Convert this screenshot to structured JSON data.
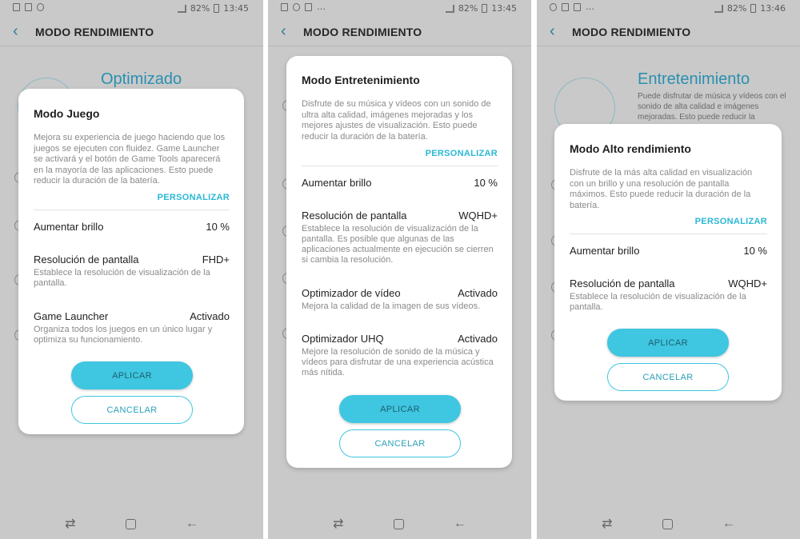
{
  "status": {
    "time1": "13:45",
    "time2": "13:45",
    "time3": "13:46",
    "battery": "82%"
  },
  "header_title": "MODO RENDIMIENTO",
  "colors": {
    "accent": "#3fc6e0",
    "link": "#2ab8d6",
    "background_title": "#2a8fb0"
  },
  "screen1": {
    "bg_title": "Optimizado",
    "dialog": {
      "title": "Modo Juego",
      "description": "Mejora su experiencia de juego haciendo que los juegos se ejecuten con fluidez. Game Launcher se activará y el botón de Game Tools aparecerá en la mayoría de las aplicaciones. Esto puede reducir la duración de la batería.",
      "customize": "PERSONALIZAR",
      "rows": [
        {
          "label": "Aumentar brillo",
          "value": "10 %",
          "sub": ""
        },
        {
          "label": "Resolución de pantalla",
          "value": "FHD+",
          "sub": "Establece la resolución de visualización de la pantalla."
        },
        {
          "label": "Game Launcher",
          "value": "Activado",
          "sub": "Organiza todos los juegos en un único lugar y optimiza su funcionamiento."
        }
      ],
      "apply": "APLICAR",
      "cancel": "CANCELAR"
    }
  },
  "screen2": {
    "dialog": {
      "title": "Modo Entretenimiento",
      "description": "Disfrute de su música y vídeos con un sonido de ultra alta calidad, imágenes mejoradas y los mejores ajustes de visualización. Esto puede reducir la duración de la batería.",
      "customize": "PERSONALIZAR",
      "rows": [
        {
          "label": "Aumentar brillo",
          "value": "10 %",
          "sub": ""
        },
        {
          "label": "Resolución de pantalla",
          "value": "WQHD+",
          "sub": "Establece la resolución de visualización de la pantalla. Es posible que algunas de las aplicaciones actualmente en ejecución se cierren si cambia la resolución."
        },
        {
          "label": "Optimizador de vídeo",
          "value": "Activado",
          "sub": "Mejora la calidad de la imagen de sus vídeos."
        },
        {
          "label": "Optimizador UHQ",
          "value": "Activado",
          "sub": "Mejore la resolución de sonido de la música y vídeos para disfrutar de una experiencia acústica más nítida."
        }
      ],
      "apply": "APLICAR",
      "cancel": "CANCELAR"
    }
  },
  "screen3": {
    "bg_title": "Entretenimiento",
    "bg_desc": "Puede disfrutar de música y vídeos con el sonido de alta calidad e imágenes mejoradas. Esto puede reducir la",
    "dialog": {
      "title": "Modo Alto rendimiento",
      "description": "Disfrute de la más alta calidad en visualización con un brillo y una resolución de pantalla máximos. Esto puede reducir la duración de la batería.",
      "customize": "PERSONALIZAR",
      "rows": [
        {
          "label": "Aumentar brillo",
          "value": "10 %",
          "sub": ""
        },
        {
          "label": "Resolución de pantalla",
          "value": "WQHD+",
          "sub": "Establece la resolución de visualización de la pantalla."
        }
      ],
      "apply": "APLICAR",
      "cancel": "CANCELAR"
    }
  }
}
